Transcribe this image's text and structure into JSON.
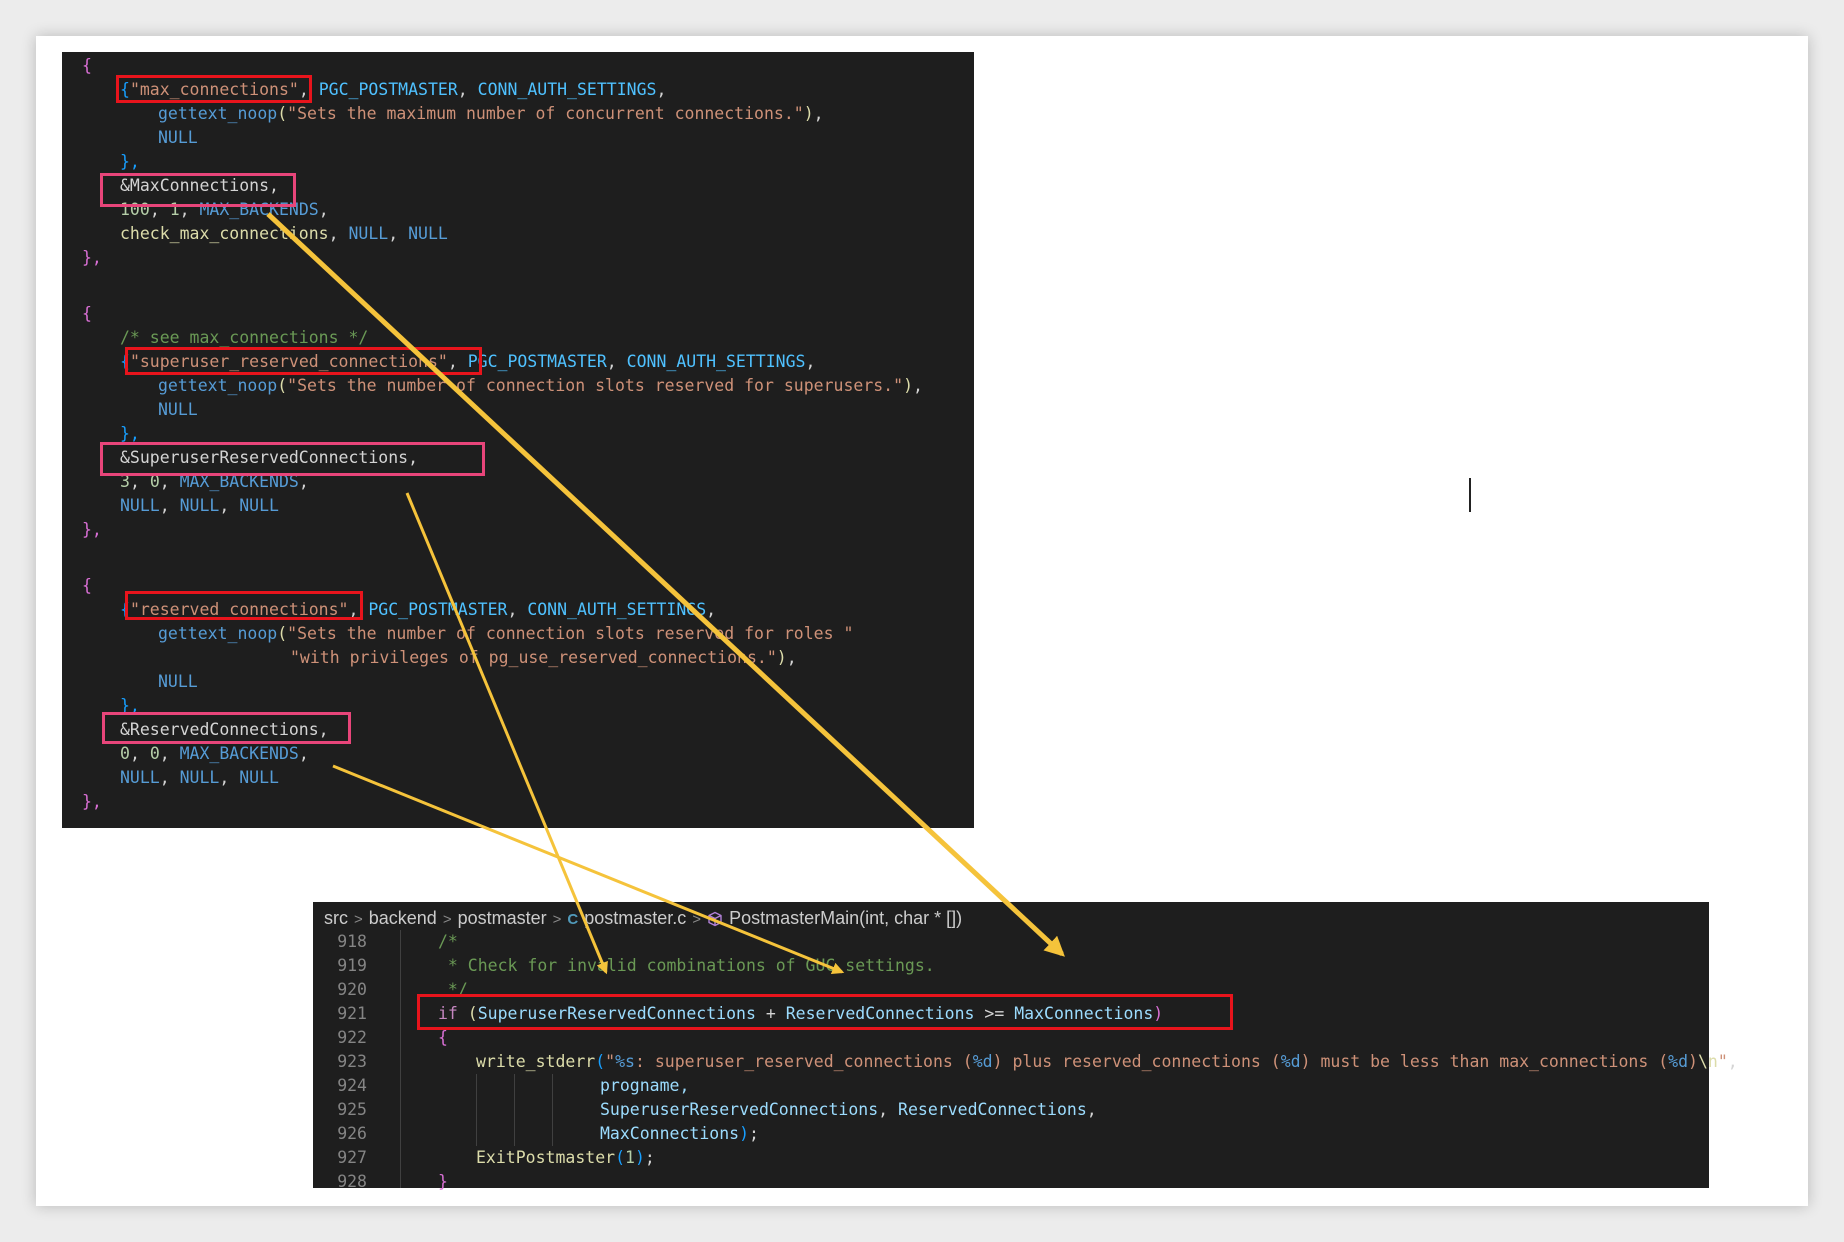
{
  "top_code": {
    "l0": "{",
    "l1_open": "{",
    "l1_name": "\"max_connections\"",
    "l1_comma": ", ",
    "l1_ctx": "PGC_POSTMASTER",
    "l1_comma2": ", ",
    "l1_group": "CONN_AUTH_SETTINGS",
    "l1_end": ",",
    "l2_fn": "gettext_noop",
    "l2_open": "(",
    "l2_str": "\"Sets the maximum number of concurrent connections.\"",
    "l2_close": ")",
    "l2_end": ",",
    "l3": "NULL",
    "l4": "},",
    "l5": "&MaxConnections,",
    "l6_a": "100",
    "l6_b": ", ",
    "l6_c": "1",
    "l6_d": ", ",
    "l6_e": "MAX_BACKENDS",
    "l6_f": ",",
    "l7_fn": "check_max_connections",
    "l7_b": ", ",
    "l7_c": "NULL",
    "l7_d": ", ",
    "l7_e": "NULL",
    "l8": "},",
    "l10": "{",
    "l11": "/* see max_connections */",
    "l12_open": "{",
    "l12_name": "\"superuser_reserved_connections\"",
    "l12_comma": ", ",
    "l12_ctx": "PGC_POSTMASTER",
    "l12_comma2": ", ",
    "l12_group": "CONN_AUTH_SETTINGS",
    "l12_end": ",",
    "l13_fn": "gettext_noop",
    "l13_open": "(",
    "l13_str": "\"Sets the number of connection slots reserved for superusers.\"",
    "l13_close": ")",
    "l13_end": ",",
    "l14": "NULL",
    "l15": "},",
    "l16": "&SuperuserReservedConnections,",
    "l17_a": "3",
    "l17_b": ", ",
    "l17_c": "0",
    "l17_d": ", ",
    "l17_e": "MAX_BACKENDS",
    "l17_f": ",",
    "l18_a": "NULL",
    "l18_b": ", ",
    "l18_c": "NULL",
    "l18_d": ", ",
    "l18_e": "NULL",
    "l19": "},",
    "l21": "{",
    "l22_open": "{",
    "l22_name": "\"reserved_connections\"",
    "l22_comma": ", ",
    "l22_ctx": "PGC_POSTMASTER",
    "l22_comma2": ", ",
    "l22_group": "CONN_AUTH_SETTINGS",
    "l22_end": ",",
    "l23_fn": "gettext_noop",
    "l23_open": "(",
    "l23_str": "\"Sets the number of connection slots reserved for roles \"",
    "l24_str": "\"with privileges of pg_use_reserved_connections.\"",
    "l24_close": ")",
    "l24_end": ",",
    "l25": "NULL",
    "l26": "},",
    "l27": "&ReservedConnections,",
    "l28_a": "0",
    "l28_b": ", ",
    "l28_c": "0",
    "l28_d": ", ",
    "l28_e": "MAX_BACKENDS",
    "l28_f": ",",
    "l29_a": "NULL",
    "l29_b": ", ",
    "l29_c": "NULL",
    "l29_d": ", ",
    "l29_e": "NULL",
    "l30": "},"
  },
  "breadcrumb": {
    "items": [
      "src",
      "backend",
      "postmaster",
      "postmaster.c",
      "PostmasterMain(int, char * [])"
    ],
    "separator": ">"
  },
  "editor": {
    "line_numbers": [
      "918",
      "919",
      "920",
      "921",
      "922",
      "923",
      "924",
      "925",
      "926",
      "927",
      "928"
    ],
    "l918": "/*",
    "l919": " * Check for invalid combinations of GUC settings.",
    "l920": " */",
    "l921_kw": "if",
    "l921_open": " (",
    "l921_a": "SuperuserReservedConnections",
    "l921_op1": " + ",
    "l921_b": "ReservedConnections",
    "l921_op2": " >= ",
    "l921_c": "MaxConnections",
    "l921_close": ")",
    "l922": "{",
    "l923_fn": "write_stderr",
    "l923_open": "(",
    "l923_s1": "\"",
    "l923_f1": "%s",
    "l923_s2": ": superuser_reserved_connections (",
    "l923_f2": "%d",
    "l923_s3": ") plus reserved_connections (",
    "l923_f3": "%d",
    "l923_s4": ") must be less than max_connections (",
    "l923_f4": "%d",
    "l923_s5": ")",
    "l923_esc": "\\n",
    "l923_s6": "\"",
    "l923_end": ",",
    "l924": "progname,",
    "l925_a": "SuperuserReservedConnections",
    "l925_b": ", ",
    "l925_c": "ReservedConnections",
    "l925_d": ",",
    "l926_a": "MaxConnections",
    "l926_b": ")",
    "l926_c": ";",
    "l927_fn": "ExitPostmaster",
    "l927_open": "(",
    "l927_num": "1",
    "l927_close": ")",
    "l927_end": ";",
    "l928": "}"
  },
  "colors": {
    "annotation_red": "#e8141c",
    "annotation_pink": "#e8457a",
    "arrow_yellow": "#f5c33b",
    "editor_background": "#1e1e1e"
  }
}
